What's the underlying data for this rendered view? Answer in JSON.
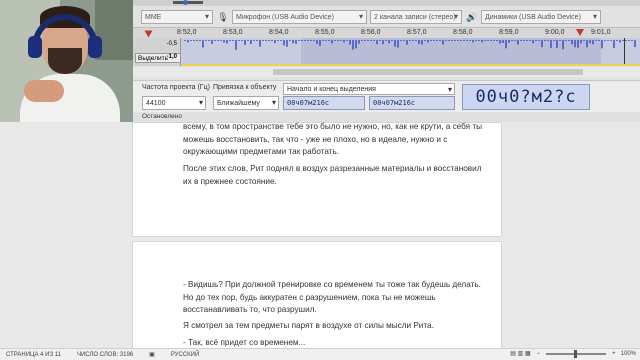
{
  "audacity": {
    "host": "MME",
    "microphone": "Микрофон (USB Audio Device)",
    "channels": "2 канала записи (стерео)",
    "speakers": "Динамики (USB Audio Device)",
    "ruler_ticks": [
      "8:52,0",
      "8:53,0",
      "8:54,0",
      "8:55,0",
      "8:56,0",
      "8:57,0",
      "8:58,0",
      "8:59,0",
      "9:00,0",
      "9:01,0"
    ],
    "track": {
      "scale_top": "-0,5",
      "scale_bottom": "-1,0",
      "select_button": "Выделить"
    },
    "selection_toolbar": {
      "rate_label": "Частота проекта (Гц)",
      "rate_value": "44100",
      "snap_label": "Привязка к объекту",
      "snap_value": "Ближайшему",
      "range_label": "Начало и конец выделения",
      "start_time": "00ч07м216с",
      "end_time": "00ч07м216с",
      "big_time": "00ч0?м2?с"
    },
    "status": "Остановлено"
  },
  "document": {
    "page1": {
      "paragraph1": "всему, в том пространстве тебе это было не нужно, но, как не крути, а себя ты можешь восстановить, так что - уже не плохо, но в идеале, нужно и с окружающими предметами так работать.",
      "paragraph2": "После этих слов, Рит поднял в воздух разрезанные материалы и восстановил их в прежнее состояние."
    },
    "page2": {
      "paragraph1": "- Видишь? При должной тренировке со временем ты тоже так будешь делать. Но до тех пор, будь аккуратен с разрушением, пока ты не можешь восстанавливать то, что разрушил.",
      "paragraph2": "Я смотрел за тем предметы парят в воздухе от силы мысли Рита.",
      "paragraph3": "- Так, всё придет со временем..."
    }
  },
  "word_status": {
    "page": "СТРАНИЦА 4 ИЗ 11",
    "words": "ЧИСЛО СЛОВ: 3196",
    "language": "РУССКИЙ",
    "zoom": "100%"
  },
  "colors": {
    "audacity_bg": "#e2e2e2",
    "waveform": "#3148c4",
    "time_display": "#cdd6f1",
    "play_marker": "#c0392b"
  }
}
